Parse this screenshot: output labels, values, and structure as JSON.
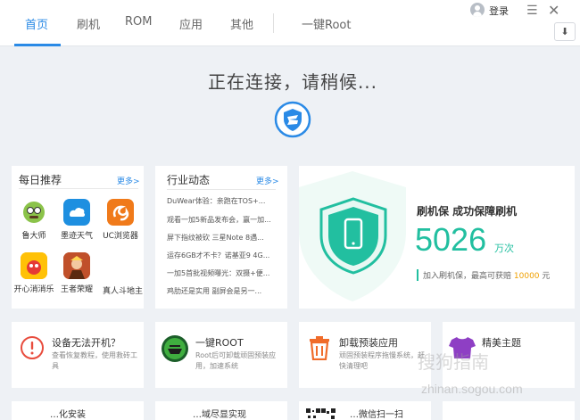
{
  "nav": {
    "tabs": [
      "首页",
      "刷机",
      "ROM",
      "应用",
      "其他",
      "一键Root"
    ],
    "login": "登录"
  },
  "status": {
    "text": "正在连接，请稍候..."
  },
  "daily": {
    "title": "每日推荐",
    "more": "更多>",
    "apps": [
      {
        "name": "鲁大师",
        "icon": "ludashi-icon"
      },
      {
        "name": "墨迹天气",
        "icon": "weather-icon"
      },
      {
        "name": "UC浏览器",
        "icon": "uc-browser-icon"
      },
      {
        "name": "开心消消乐",
        "icon": "candy-game-icon"
      },
      {
        "name": "王者荣耀",
        "icon": "kings-glory-icon"
      },
      {
        "name": "真人斗地主",
        "icon": "card-game-icon"
      }
    ]
  },
  "news": {
    "title": "行业动态",
    "more": "更多>",
    "items": [
      "DuWear体验：亲跑在TOS+...",
      "观看一加5新品发布会，赢一加...",
      "屏下指纹被砍 三星Note 8遇...",
      "运存6GB才不卡？诺基亚9 4G...",
      "一加5首批视频曝光：双摄+便...",
      "鸡肋还是实用 副屏会是另一..."
    ]
  },
  "stat": {
    "title": "刷机保  成功保障刷机",
    "number": "5026",
    "unit": "万次",
    "note_prefix": "加入刷机保，最高可获赔",
    "note_amount": "10000",
    "note_suffix": "元"
  },
  "features": [
    {
      "title": "设备无法开机？",
      "desc": "查看恢复教程，使用救砖工具",
      "icon": "warning-icon"
    },
    {
      "title": "一键ROOT",
      "desc": "Root后可卸载顽固预装应用，加速系统",
      "icon": "root-icon"
    },
    {
      "title": "卸载预装应用",
      "desc": "顽固预装程序拖慢系统，赶快清理吧",
      "icon": "trash-icon"
    },
    {
      "title": "精美主题",
      "desc": "",
      "icon": "tshirt-icon"
    }
  ],
  "watermark": {
    "text": "搜狗指南",
    "url": "zhinan.sogou.com"
  },
  "bottom_row": [
    "…化安装",
    "…域尽显实现",
    "…微信扫一扫"
  ]
}
